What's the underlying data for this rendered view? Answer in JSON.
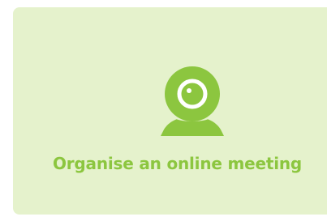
{
  "card": {
    "title": "Organise an online meeting",
    "icon": "webcam-icon",
    "colors": {
      "background": "#e5f2cc",
      "accent": "#8cc63f",
      "lens_ring": "#ffffff"
    }
  }
}
